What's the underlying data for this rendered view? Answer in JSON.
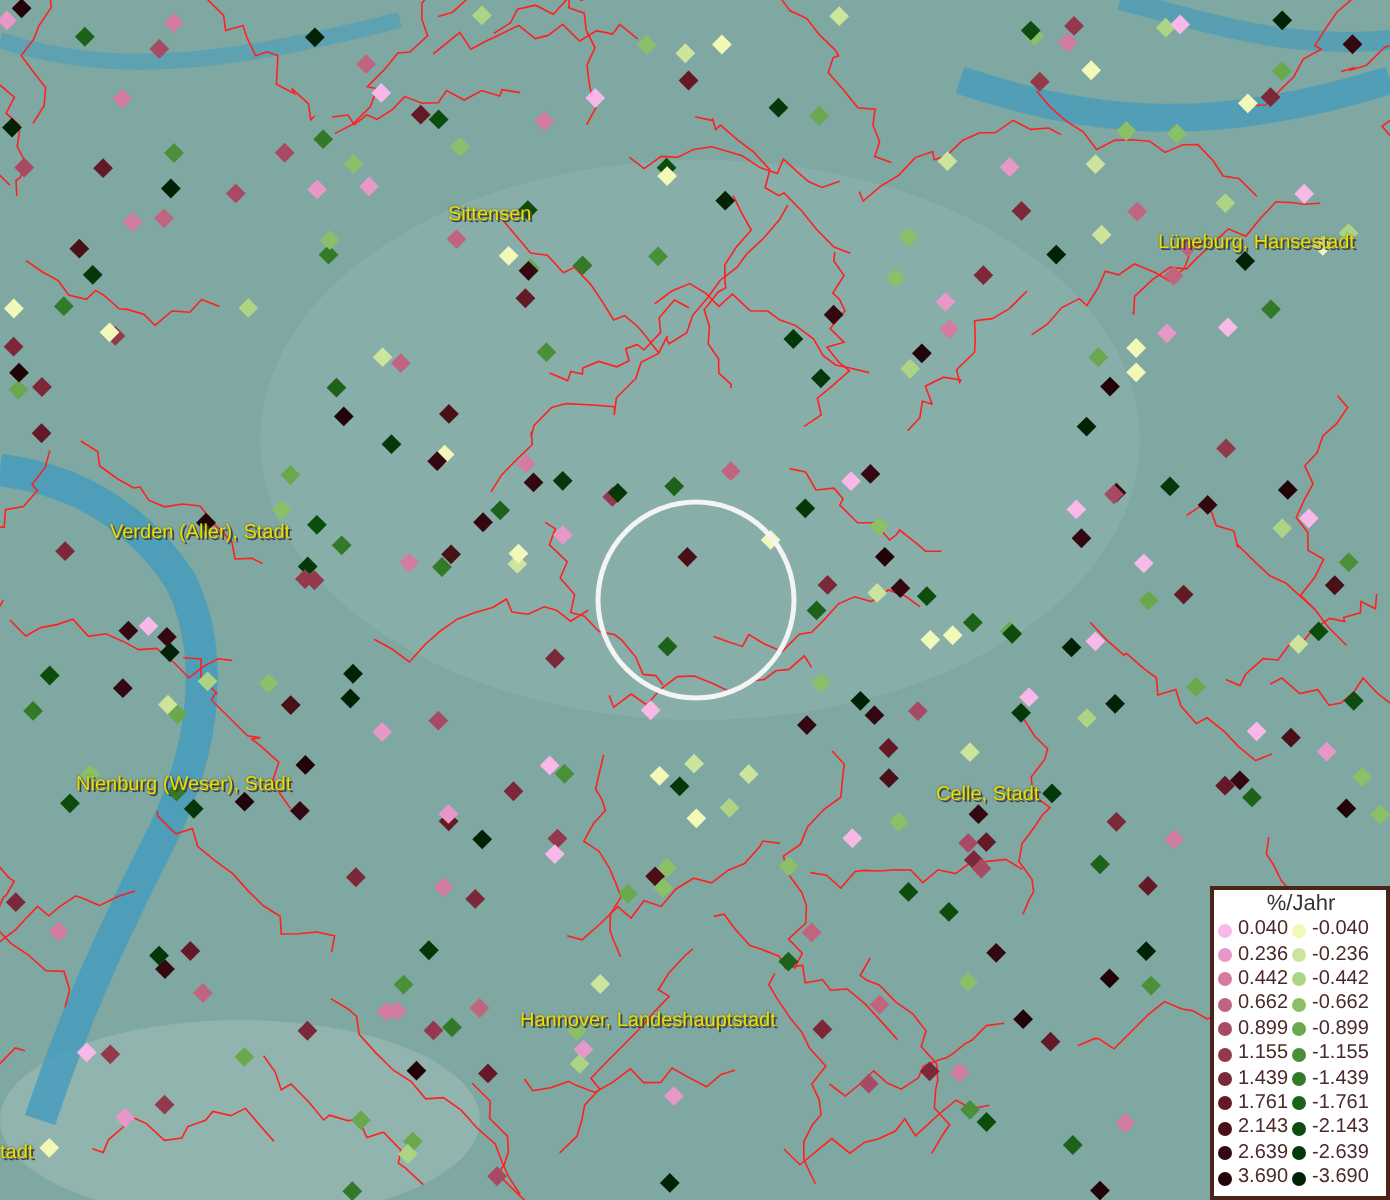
{
  "map": {
    "places": [
      {
        "name": "Sittensen"
      },
      {
        "name": "Lüneburg, Hansestadt"
      },
      {
        "name": "Verden (Aller), Stadt"
      },
      {
        "name": "Nienburg (Weser), Stadt"
      },
      {
        "name": "Celle, Stadt"
      },
      {
        "name": "Hannover, Landeshauptstadt"
      },
      {
        "name": "tadt"
      }
    ]
  },
  "legend": {
    "title": "%/Jahr",
    "columns": [
      [
        {
          "label": "0.040",
          "color": "#f8b8e8"
        },
        {
          "label": "0.236",
          "color": "#e898c8"
        },
        {
          "label": "0.442",
          "color": "#d47ca0"
        },
        {
          "label": "0.662",
          "color": "#c06480"
        },
        {
          "label": "0.899",
          "color": "#a84a64"
        },
        {
          "label": "1.155",
          "color": "#94384c"
        },
        {
          "label": "1.439",
          "color": "#7c2838"
        },
        {
          "label": "1.761",
          "color": "#641a26"
        },
        {
          "label": "2.143",
          "color": "#4a1018"
        },
        {
          "label": "2.639",
          "color": "#340810"
        },
        {
          "label": "3.690",
          "color": "#220408"
        }
      ],
      [
        {
          "label": "-0.040",
          "color": "#f2f8b8"
        },
        {
          "label": "-0.236",
          "color": "#cce49c"
        },
        {
          "label": "-0.442",
          "color": "#acd484"
        },
        {
          "label": "-0.662",
          "color": "#8cc068"
        },
        {
          "label": "-0.899",
          "color": "#6aa84e"
        },
        {
          "label": "-1.155",
          "color": "#4a9038"
        },
        {
          "label": "-1.439",
          "color": "#327a28"
        },
        {
          "label": "-1.761",
          "color": "#1c621a"
        },
        {
          "label": "-2.143",
          "color": "#0c4c0c"
        },
        {
          "label": "-2.639",
          "color": "#043808"
        },
        {
          "label": "-3.690",
          "color": "#022206"
        }
      ]
    ]
  }
}
